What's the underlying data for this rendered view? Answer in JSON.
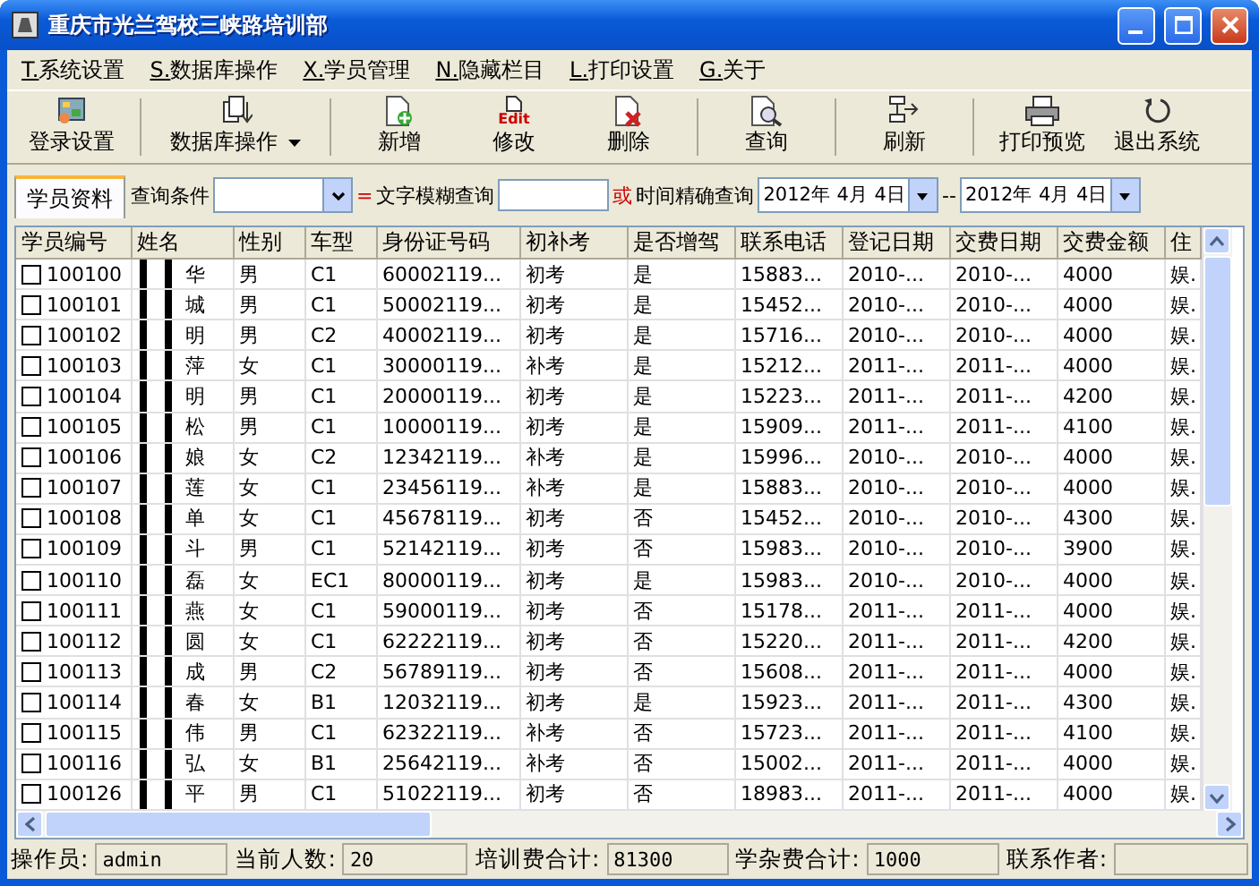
{
  "window": {
    "title": "重庆市光兰驾校三峡路培训部"
  },
  "menu": [
    {
      "key": "T.",
      "label": "系统设置"
    },
    {
      "key": "S.",
      "label": "数据库操作"
    },
    {
      "key": "X.",
      "label": "学员管理"
    },
    {
      "key": "N.",
      "label": "隐藏栏目"
    },
    {
      "key": "L.",
      "label": "打印设置"
    },
    {
      "key": "G.",
      "label": "关于"
    }
  ],
  "toolbar": [
    {
      "kind": "login",
      "label": "登录设置",
      "dropdown": false
    },
    {
      "kind": "database",
      "label": "数据库操作",
      "dropdown": true
    },
    {
      "kind": "add",
      "label": "新增",
      "dropdown": false
    },
    {
      "kind": "edit",
      "label": "修改",
      "icon_text": "Edit",
      "dropdown": false
    },
    {
      "kind": "delete",
      "label": "删除",
      "dropdown": false
    },
    {
      "kind": "query",
      "label": "查询",
      "dropdown": false
    },
    {
      "kind": "refresh",
      "label": "刷新",
      "dropdown": false
    },
    {
      "kind": "print",
      "label": "打印预览",
      "dropdown": false
    },
    {
      "kind": "exit",
      "label": "退出系统",
      "dropdown": false
    }
  ],
  "tabs": [
    {
      "label": "学员资料",
      "selected": true
    }
  ],
  "search": {
    "condition_label": "查询条件",
    "equals": "=",
    "fuzzy_label": "文字模糊查询",
    "or": "或",
    "exact_label": "时间精确查询",
    "date_from": "2012年 4月 4日",
    "separator": "--",
    "date_to": "2012年 4月 4日"
  },
  "table": {
    "columns": [
      "学员编号",
      "姓名",
      "性别",
      "车型",
      "身份证号码",
      "初补考",
      "是否增驾",
      "联系电话",
      "登记日期",
      "交费日期",
      "交费金额",
      "住"
    ],
    "rows": [
      {
        "checked": false,
        "cells": [
          "100100",
          "华",
          "男",
          "C1",
          "60002119...",
          "初考",
          "是",
          "15883...",
          "2010-...",
          "2010-...",
          "4000",
          "娱."
        ]
      },
      {
        "checked": false,
        "cells": [
          "100101",
          "城",
          "男",
          "C1",
          "50002119...",
          "初考",
          "是",
          "15452...",
          "2010-...",
          "2010-...",
          "4000",
          "娱."
        ]
      },
      {
        "checked": false,
        "cells": [
          "100102",
          "明",
          "男",
          "C2",
          "40002119...",
          "初考",
          "是",
          "15716...",
          "2010-...",
          "2010-...",
          "4000",
          "娱."
        ]
      },
      {
        "checked": false,
        "cells": [
          "100103",
          "萍",
          "女",
          "C1",
          "30000119...",
          "补考",
          "是",
          "15212...",
          "2011-...",
          "2011-...",
          "4000",
          "娱."
        ]
      },
      {
        "checked": false,
        "cells": [
          "100104",
          "明",
          "男",
          "C1",
          "20000119...",
          "初考",
          "是",
          "15223...",
          "2011-...",
          "2011-...",
          "4200",
          "娱."
        ]
      },
      {
        "checked": false,
        "cells": [
          "100105",
          "松",
          "男",
          "C1",
          "10000119...",
          "初考",
          "是",
          "15909...",
          "2011-...",
          "2011-...",
          "4100",
          "娱."
        ]
      },
      {
        "checked": false,
        "cells": [
          "100106",
          "娘",
          "女",
          "C2",
          "12342119...",
          "补考",
          "是",
          "15996...",
          "2010-...",
          "2010-...",
          "4000",
          "娱."
        ]
      },
      {
        "checked": false,
        "cells": [
          "100107",
          "莲",
          "女",
          "C1",
          "23456119...",
          "补考",
          "是",
          "15883...",
          "2010-...",
          "2010-...",
          "4000",
          "娱."
        ]
      },
      {
        "checked": false,
        "cells": [
          "100108",
          "单",
          "女",
          "C1",
          "45678119...",
          "初考",
          "否",
          "15452...",
          "2010-...",
          "2010-...",
          "4300",
          "娱."
        ]
      },
      {
        "checked": false,
        "cells": [
          "100109",
          "斗",
          "男",
          "C1",
          "52142119...",
          "初考",
          "否",
          "15983...",
          "2010-...",
          "2010-...",
          "3900",
          "娱."
        ]
      },
      {
        "checked": false,
        "cells": [
          "100110",
          "磊",
          "女",
          "EC1",
          "80000119...",
          "初考",
          "是",
          "15983...",
          "2010-...",
          "2010-...",
          "4000",
          "娱."
        ]
      },
      {
        "checked": false,
        "cells": [
          "100111",
          "燕",
          "女",
          "C1",
          "59000119...",
          "初考",
          "否",
          "15178...",
          "2011-...",
          "2011-...",
          "4000",
          "娱."
        ]
      },
      {
        "checked": false,
        "cells": [
          "100112",
          "圆",
          "女",
          "C1",
          "62222119...",
          "初考",
          "否",
          "15220...",
          "2011-...",
          "2011-...",
          "4200",
          "娱."
        ]
      },
      {
        "checked": false,
        "cells": [
          "100113",
          "成",
          "男",
          "C2",
          "56789119...",
          "初考",
          "否",
          "15608...",
          "2011-...",
          "2011-...",
          "4000",
          "娱."
        ]
      },
      {
        "checked": false,
        "cells": [
          "100114",
          "春",
          "女",
          "B1",
          "12032119...",
          "初考",
          "是",
          "15923...",
          "2011-...",
          "2011-...",
          "4300",
          "娱."
        ]
      },
      {
        "checked": false,
        "cells": [
          "100115",
          "伟",
          "男",
          "C1",
          "62322119...",
          "补考",
          "否",
          "15723...",
          "2011-...",
          "2011-...",
          "4100",
          "娱."
        ]
      },
      {
        "checked": false,
        "cells": [
          "100116",
          "弘",
          "女",
          "B1",
          "25642119...",
          "补考",
          "否",
          "15002...",
          "2011-...",
          "2011-...",
          "4000",
          "娱."
        ]
      },
      {
        "checked": false,
        "cells": [
          "100126",
          "平",
          "男",
          "C1",
          "51022119...",
          "初考",
          "否",
          "18983...",
          "2011-...",
          "2011-...",
          "4000",
          "娱."
        ]
      }
    ]
  },
  "status_bar": [
    {
      "label": "操作员:",
      "value": "admin"
    },
    {
      "label": "当前人数:",
      "value": "20"
    },
    {
      "label": "培训费合计:",
      "value": "81300"
    },
    {
      "label": "学杂费合计:",
      "value": "1000"
    },
    {
      "label": "联系作者:"
    }
  ]
}
